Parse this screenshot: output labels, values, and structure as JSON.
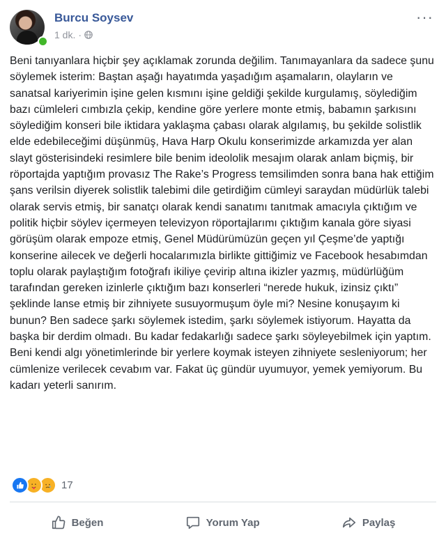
{
  "post": {
    "author": "Burcu Soysev",
    "timestamp": "1 dk.",
    "separator": "·",
    "privacy_icon": "globe-icon",
    "menu_label": "···",
    "text": "Beni tanıyanlara hiçbir şey açıklamak zorunda değilim. Tanımayanlara da sadece şunu söylemek isterim: Baştan aşağı hayatımda yaşadığım aşamaların, olayların ve sanatsal kariyerimin işine gelen kısmını işine geldiği şekilde kurgulamış, söylediğim bazı cümleleri cımbızla çekip, kendine göre yerlere monte etmiş, babamın şarkısını söylediğim konseri bile iktidara yaklaşma çabası olarak algılamış, bu şekilde solistlik elde edebileceğimi düşünmüş, Hava Harp Okulu konserimizde arkamızda yer alan slayt gösterisindeki resimlere bile benim ideololik mesajım olarak anlam biçmiş, bir röportajda yaptığım provasız The Rake’s Progress temsilimden sonra bana hak ettiğim şans verilsin diyerek solistlik talebimi dile getirdiğim cümleyi saraydan müdürlük talebi olarak servis etmiş, bir sanatçı olarak kendi sanatımı tanıtmak amacıyla çıktığım ve politik hiçbir söylev içermeyen televizyon röportajlarımı çıktığım kanala göre siyasi görüşüm olarak empoze etmiş, Genel Müdürümüzün geçen yıl Çeşme’de yaptığı konserine ailecek ve değerli hocalarımızla birlikte gittiğimiz ve Facebook hesabımdan toplu olarak paylaştığım fotoğrafı ikiliye çevirip altına ikizler yazmış, müdürlüğüm tarafından gereken izinlerle çıktığım bazı konserleri “nerede hukuk, izinsiz çıktı” şeklinde lanse etmiş bir zihniyete susuyormuşum öyle mi? Nesine konuşayım ki bunun? Ben sadece şarkı söylemek istedim, şarkı söylemek istiyorum. Hayatta da başka bir derdim olmadı. Bu kadar fedakarlığı sadece şarkı söyleyebilmek için yaptım. Beni kendi algı yönetimlerinde bir yerlere koymak isteyen zihniyete sesleniyorum; her cümlenize verilecek cevabım var. Fakat üç gündür uyumuyor, yemek yemiyorum. Bu kadarı yeterli sanırım."
  },
  "reactions": {
    "icons": [
      "like-icon",
      "care-icon",
      "sad-icon"
    ],
    "count": "17",
    "colors": {
      "like": "#1877f2",
      "care": "#f7b125",
      "sad": "#f7b125"
    }
  },
  "actions": {
    "like_label": "Beğen",
    "comment_label": "Yorum Yap",
    "share_label": "Paylaş"
  },
  "colors": {
    "author": "#385898",
    "meta": "#90949c",
    "action": "#606770",
    "online": "#42b72a"
  }
}
